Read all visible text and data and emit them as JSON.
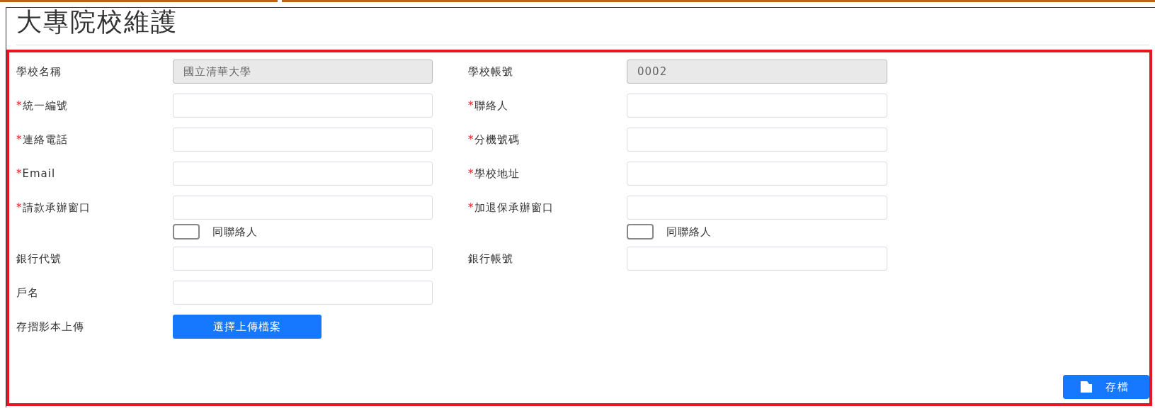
{
  "title": "大專院校維護",
  "rows": [
    {
      "kind": "fields",
      "cells": [
        {
          "label": "學校名稱",
          "value": "國立清華大學",
          "disabled": true
        },
        {
          "label": "學校帳號",
          "value": "0002",
          "disabled": true
        }
      ]
    },
    {
      "kind": "fields",
      "cells": [
        {
          "mark": "*",
          "label": "統一編號",
          "disabled": false
        },
        {
          "mark": "*",
          "label": "聯絡人",
          "disabled": false
        }
      ]
    },
    {
      "kind": "fields",
      "cells": [
        {
          "mark": "*",
          "label": "連絡電話",
          "disabled": false
        },
        {
          "mark": "*",
          "label": "分機號碼",
          "disabled": false
        }
      ]
    },
    {
      "kind": "fields",
      "cells": [
        {
          "mark": "*",
          "label": "Email",
          "disabled": false
        },
        {
          "mark": "*",
          "label": "學校地址",
          "disabled": false
        }
      ]
    },
    {
      "kind": "fields",
      "cells": [
        {
          "mark": "*",
          "label": "請款承辦窗口",
          "disabled": false
        },
        {
          "mark": "*",
          "label": "加退保承辦窗口",
          "disabled": false
        }
      ]
    },
    {
      "kind": "checkboxes",
      "cells": [
        {
          "label": "同聯絡人",
          "checked": false
        },
        {
          "label": "同聯絡人",
          "checked": false
        }
      ]
    },
    {
      "kind": "fields",
      "cells": [
        {
          "label": "銀行代號",
          "disabled": false
        },
        {
          "label": "銀行帳號",
          "disabled": false
        }
      ]
    },
    {
      "kind": "fields",
      "cells": [
        {
          "label": "戶名",
          "disabled": false
        }
      ]
    },
    {
      "kind": "upload",
      "cells": [
        {
          "label": "存摺影本上傳",
          "button": "選擇上傳檔案"
        }
      ]
    }
  ],
  "save_button": "存檔"
}
